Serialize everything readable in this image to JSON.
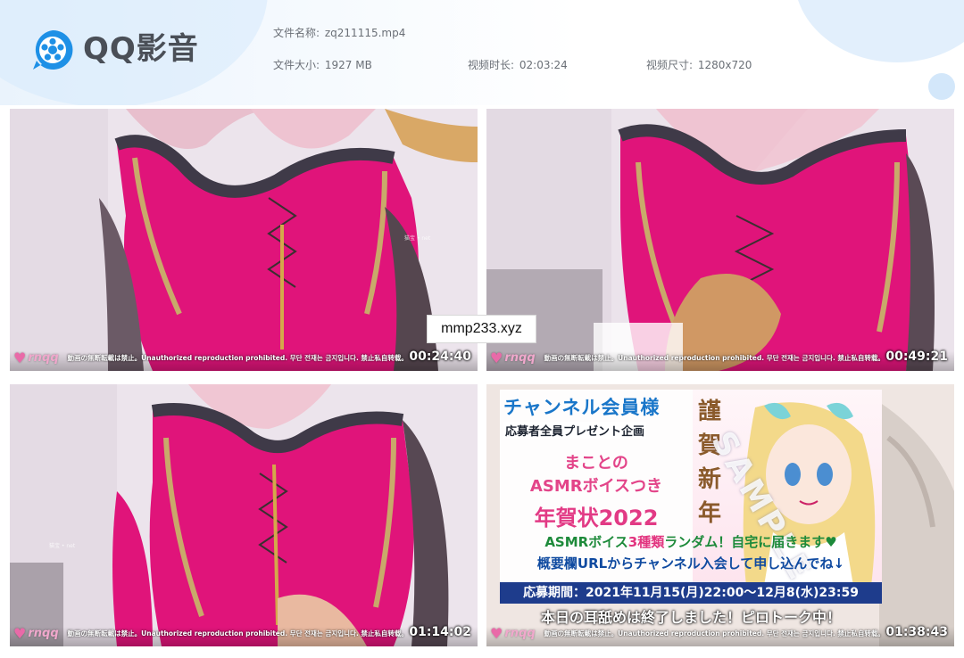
{
  "app": {
    "brand": "QQ影音"
  },
  "file_info": {
    "name_label": "文件名称:",
    "name_value": "zq211115.mp4",
    "size_label": "文件大小:",
    "size_value": "1927 MB",
    "duration_label": "视频时长:",
    "duration_value": "02:03:24",
    "dimension_label": "视频尺寸:",
    "dimension_value": "1280x720"
  },
  "overlay_text": "mmp233.xyz",
  "watermark": {
    "channel": "rnqq",
    "notice": "動画の無断転載は禁止。Unauthorized reproduction prohibited. 무단 전재는 금지입니다. 禁止私自转载。"
  },
  "small_text": "猫宝 • net",
  "thumbnails": [
    {
      "timestamp": "00:24:40"
    },
    {
      "timestamp": "00:49:21"
    },
    {
      "timestamp": "01:14:02"
    },
    {
      "timestamp": "01:38:43"
    }
  ],
  "banner": {
    "title": "チャンネル会員様",
    "subtitle": "応募者全員プレゼント企画",
    "line1": "まことの",
    "line2": "ASMRボイスつき",
    "line3": "年賀状2022",
    "asmr_pre": "ASMRボイス",
    "asmr_pink": "3種類",
    "asmr_post": "ランダム！自宅に届きます♥",
    "url_line": "概要欄URLからチャンネル入会して申し込んでね↓",
    "period": "応募期間：2021年11月15(月)22:00〜12月8(水)23:59",
    "end_note": "本日の耳舐めは終了しました！ピロトーク中！",
    "kanji": "謹賀新年",
    "sample": "SAMPLE"
  },
  "colors": {
    "dress": "#e0147a",
    "lace": "#c9a96a",
    "accent": "#1e90e6"
  }
}
